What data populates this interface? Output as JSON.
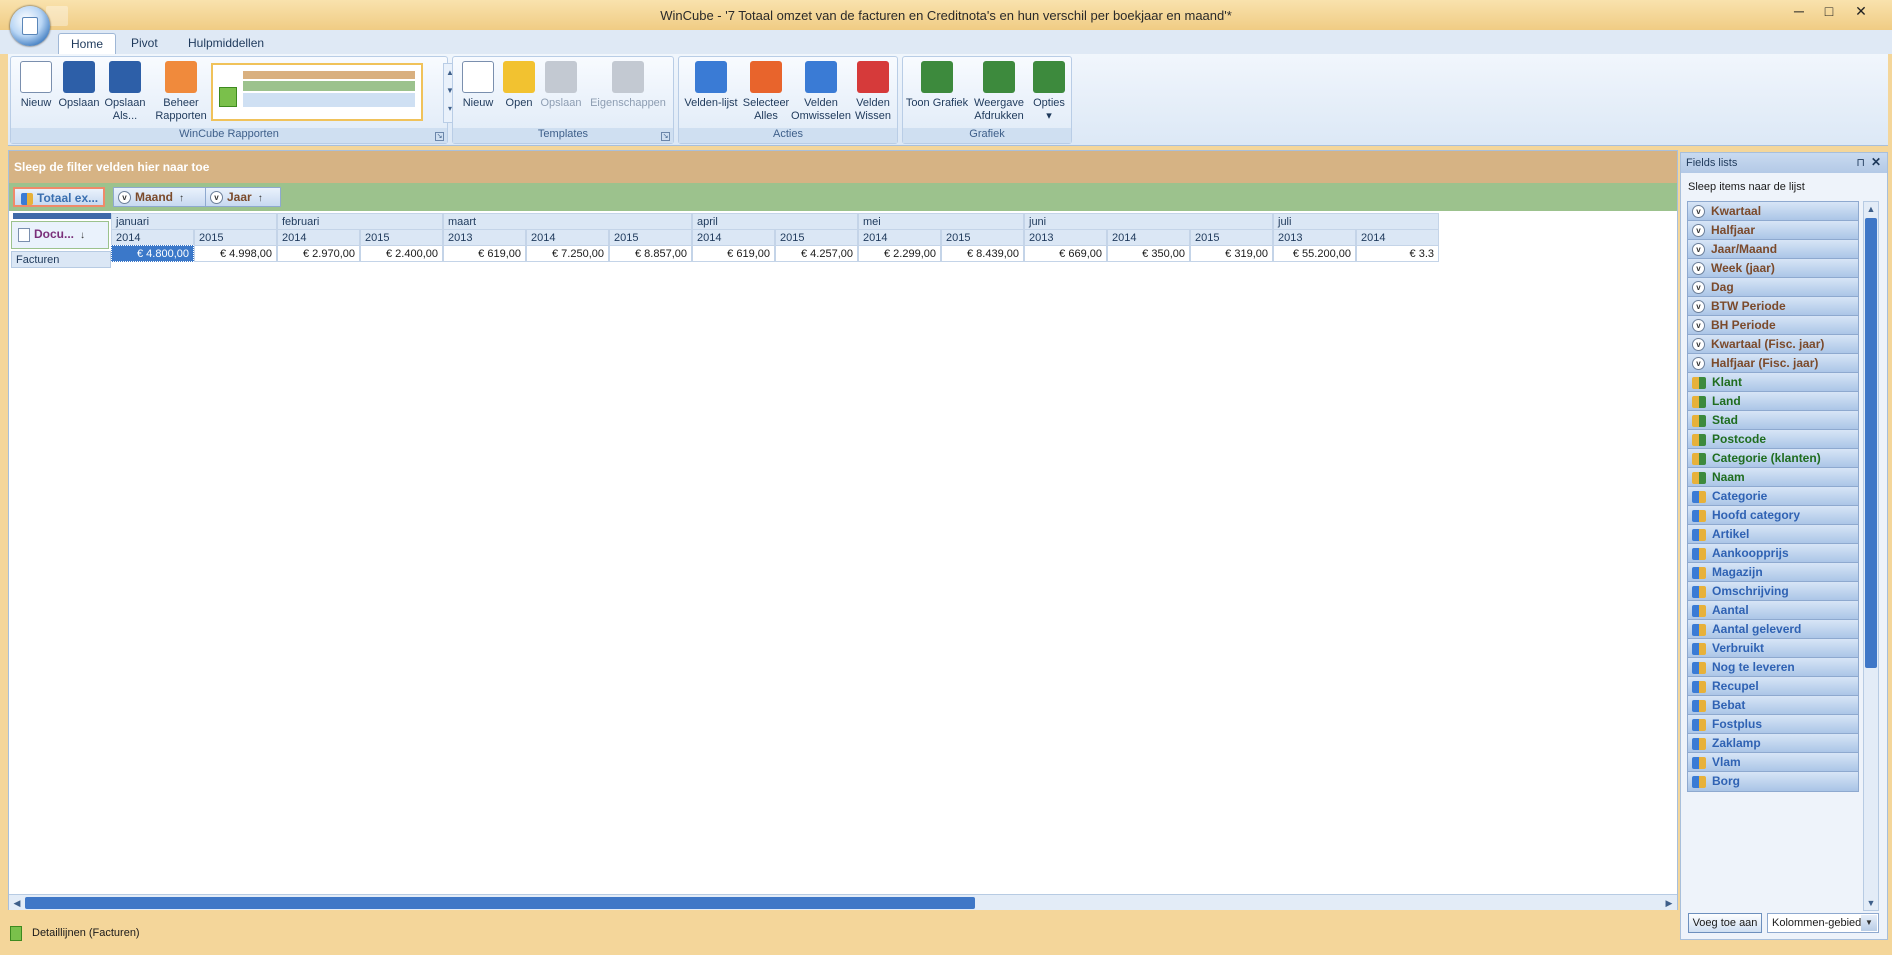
{
  "window": {
    "title": "WinCube - '7 Totaal omzet van de facturen en Creditnota's en hun verschil per boekjaar en maand'*",
    "min": "─",
    "max": "□",
    "close": "✕"
  },
  "tabs": [
    "Home",
    "Pivot",
    "Hulpmiddellen"
  ],
  "ribbon": {
    "groups": {
      "rapporten": "WinCube Rapporten",
      "templates": "Templates",
      "acties": "Acties",
      "grafiek": "Grafiek"
    },
    "buttons": {
      "nieuw": "Nieuw",
      "opslaan": "Opslaan",
      "opslaan_als_1": "Opslaan",
      "opslaan_als_2": "Als...",
      "beheer_1": "Beheer",
      "beheer_2": "Rapporten",
      "t_nieuw": "Nieuw",
      "t_open": "Open",
      "t_opslaan": "Opslaan",
      "t_eigenschappen": "Eigenschappen",
      "velden_lijst": "Velden-lijst",
      "selecteer_1": "Selecteer",
      "selecteer_2": "Alles",
      "omwisselen_1": "Velden",
      "omwisselen_2": "Omwisselen",
      "wissen_1": "Velden",
      "wissen_2": "Wissen",
      "toon_grafiek": "Toon Grafiek",
      "weergave_1": "Weergave",
      "weergave_2": "Afdrukken",
      "opties": "Opties",
      "opties_arrow": "▾"
    },
    "colors": {
      "nieuw": "#ffffff",
      "opslaan": "#2d5fa8",
      "beheer": "#f08a3c",
      "open": "#f2c230",
      "disabled": "#c3c9d2",
      "velden_lijst": "#3a7bd5",
      "selecteer": "#e8642c",
      "omwisselen": "#3a7bd5",
      "wissen": "#d63a3a",
      "grafiek": "#3d8a3d"
    },
    "gallery_scroll": {
      "up": "▲",
      "down": "▼",
      "more": "▾"
    },
    "launcher_icon": "↘"
  },
  "pivot": {
    "filter_hint": "Sleep de filter velden hier naar toe",
    "data_field": "Totaal ex...",
    "column_fields": [
      {
        "label": "Maand",
        "sort": "↑",
        "expand": "v"
      },
      {
        "label": "Jaar",
        "sort": "↑",
        "expand": "v"
      }
    ],
    "row_field": {
      "label": "Docu...",
      "sort": "↓"
    },
    "row_label": "Facturen",
    "months": [
      {
        "name": "januari",
        "years": [
          "2014",
          "2015"
        ],
        "values": [
          "€ 4.800,00",
          "€ 4.998,00"
        ]
      },
      {
        "name": "februari",
        "years": [
          "2014",
          "2015"
        ],
        "values": [
          "€ 2.970,00",
          "€ 2.400,00"
        ]
      },
      {
        "name": "maart",
        "years": [
          "2013",
          "2014",
          "2015"
        ],
        "values": [
          "€ 619,00",
          "€ 7.250,00",
          "€ 8.857,00"
        ]
      },
      {
        "name": "april",
        "years": [
          "2014",
          "2015"
        ],
        "values": [
          "€ 619,00",
          "€ 4.257,00"
        ]
      },
      {
        "name": "mei",
        "years": [
          "2014",
          "2015"
        ],
        "values": [
          "€ 2.299,00",
          "€ 8.439,00"
        ]
      },
      {
        "name": "juni",
        "years": [
          "2013",
          "2014",
          "2015"
        ],
        "values": [
          "€ 669,00",
          "€ 350,00",
          "€ 319,00"
        ]
      },
      {
        "name": "juli",
        "years": [
          "2013",
          "2014"
        ],
        "values": [
          "€ 55.200,00",
          "€ 3.3"
        ]
      }
    ],
    "scroll": {
      "left": "◀",
      "right": "▶"
    }
  },
  "status": {
    "text": "Detaillijnen (Facturen)"
  },
  "fields_panel": {
    "title": "Fields lists",
    "pin": "⊓",
    "close": "✕",
    "hint": "Sleep items naar de lijst",
    "items": [
      {
        "label": "Kwartaal",
        "kind": "time"
      },
      {
        "label": "Halfjaar",
        "kind": "time"
      },
      {
        "label": "Jaar/Maand",
        "kind": "time"
      },
      {
        "label": "Week (jaar)",
        "kind": "time"
      },
      {
        "label": "Dag",
        "kind": "time"
      },
      {
        "label": "BTW Periode",
        "kind": "time"
      },
      {
        "label": "BH Periode",
        "kind": "time"
      },
      {
        "label": "Kwartaal (Fisc. jaar)",
        "kind": "time"
      },
      {
        "label": "Halfjaar (Fisc. jaar)",
        "kind": "time"
      },
      {
        "label": "Klant",
        "kind": "cust"
      },
      {
        "label": "Land",
        "kind": "cust"
      },
      {
        "label": "Stad",
        "kind": "cust"
      },
      {
        "label": "Postcode",
        "kind": "cust"
      },
      {
        "label": "Categorie (klanten)",
        "kind": "cust"
      },
      {
        "label": "Naam",
        "kind": "cust"
      },
      {
        "label": "Categorie",
        "kind": "prod"
      },
      {
        "label": "Hoofd category",
        "kind": "prod"
      },
      {
        "label": "Artikel",
        "kind": "prod"
      },
      {
        "label": "Aankoopprijs",
        "kind": "prod"
      },
      {
        "label": "Magazijn",
        "kind": "prod"
      },
      {
        "label": "Omschrijving",
        "kind": "prod"
      },
      {
        "label": "Aantal",
        "kind": "prod"
      },
      {
        "label": "Aantal geleverd",
        "kind": "prod"
      },
      {
        "label": "Verbruikt",
        "kind": "prod"
      },
      {
        "label": "Nog te leveren",
        "kind": "prod"
      },
      {
        "label": "Recupel",
        "kind": "prod"
      },
      {
        "label": "Bebat",
        "kind": "prod"
      },
      {
        "label": "Fostplus",
        "kind": "prod"
      },
      {
        "label": "Zaklamp",
        "kind": "prod"
      },
      {
        "label": "Vlam",
        "kind": "prod"
      },
      {
        "label": "Borg",
        "kind": "prod"
      }
    ],
    "scroll": {
      "up": "▲",
      "down": "▼"
    },
    "add_button": "Voeg toe aan",
    "area_value": "Kolommen-gebied",
    "area_arrow": "▼"
  }
}
